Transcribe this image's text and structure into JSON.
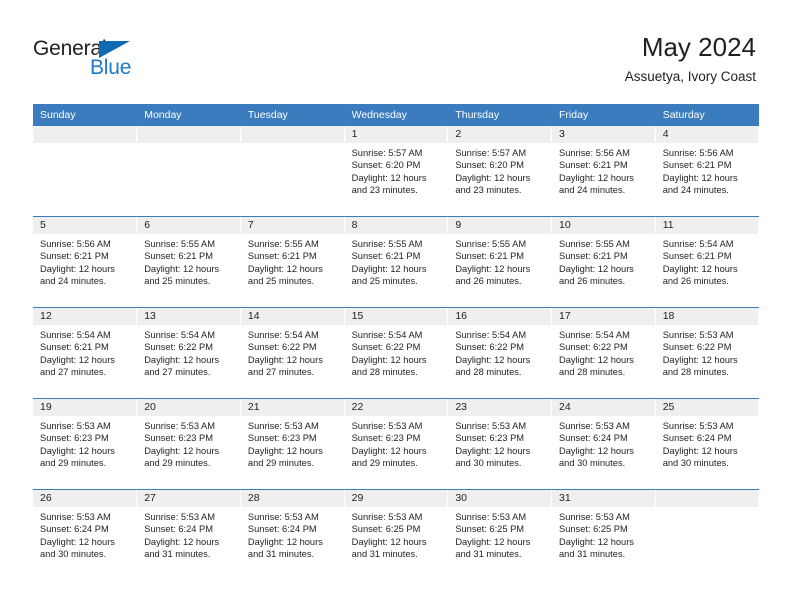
{
  "brand": {
    "name_part1": "General",
    "name_part2": "Blue",
    "triangle_icon": "triangle-icon",
    "primary_color": "#1c7ac9",
    "dark_color": "#231f20"
  },
  "header": {
    "title": "May 2024",
    "subtitle": "Assuetya, Ivory Coast"
  },
  "calendar": {
    "header_bg": "#3a7cbe",
    "daynum_bg": "#efefef",
    "weekday_headers": [
      "Sunday",
      "Monday",
      "Tuesday",
      "Wednesday",
      "Thursday",
      "Friday",
      "Saturday"
    ],
    "weeks": [
      [
        {
          "day": "",
          "lines": []
        },
        {
          "day": "",
          "lines": []
        },
        {
          "day": "",
          "lines": []
        },
        {
          "day": "1",
          "lines": [
            "Sunrise: 5:57 AM",
            "Sunset: 6:20 PM",
            "Daylight: 12 hours",
            "and 23 minutes."
          ]
        },
        {
          "day": "2",
          "lines": [
            "Sunrise: 5:57 AM",
            "Sunset: 6:20 PM",
            "Daylight: 12 hours",
            "and 23 minutes."
          ]
        },
        {
          "day": "3",
          "lines": [
            "Sunrise: 5:56 AM",
            "Sunset: 6:21 PM",
            "Daylight: 12 hours",
            "and 24 minutes."
          ]
        },
        {
          "day": "4",
          "lines": [
            "Sunrise: 5:56 AM",
            "Sunset: 6:21 PM",
            "Daylight: 12 hours",
            "and 24 minutes."
          ]
        }
      ],
      [
        {
          "day": "5",
          "lines": [
            "Sunrise: 5:56 AM",
            "Sunset: 6:21 PM",
            "Daylight: 12 hours",
            "and 24 minutes."
          ]
        },
        {
          "day": "6",
          "lines": [
            "Sunrise: 5:55 AM",
            "Sunset: 6:21 PM",
            "Daylight: 12 hours",
            "and 25 minutes."
          ]
        },
        {
          "day": "7",
          "lines": [
            "Sunrise: 5:55 AM",
            "Sunset: 6:21 PM",
            "Daylight: 12 hours",
            "and 25 minutes."
          ]
        },
        {
          "day": "8",
          "lines": [
            "Sunrise: 5:55 AM",
            "Sunset: 6:21 PM",
            "Daylight: 12 hours",
            "and 25 minutes."
          ]
        },
        {
          "day": "9",
          "lines": [
            "Sunrise: 5:55 AM",
            "Sunset: 6:21 PM",
            "Daylight: 12 hours",
            "and 26 minutes."
          ]
        },
        {
          "day": "10",
          "lines": [
            "Sunrise: 5:55 AM",
            "Sunset: 6:21 PM",
            "Daylight: 12 hours",
            "and 26 minutes."
          ]
        },
        {
          "day": "11",
          "lines": [
            "Sunrise: 5:54 AM",
            "Sunset: 6:21 PM",
            "Daylight: 12 hours",
            "and 26 minutes."
          ]
        }
      ],
      [
        {
          "day": "12",
          "lines": [
            "Sunrise: 5:54 AM",
            "Sunset: 6:21 PM",
            "Daylight: 12 hours",
            "and 27 minutes."
          ]
        },
        {
          "day": "13",
          "lines": [
            "Sunrise: 5:54 AM",
            "Sunset: 6:22 PM",
            "Daylight: 12 hours",
            "and 27 minutes."
          ]
        },
        {
          "day": "14",
          "lines": [
            "Sunrise: 5:54 AM",
            "Sunset: 6:22 PM",
            "Daylight: 12 hours",
            "and 27 minutes."
          ]
        },
        {
          "day": "15",
          "lines": [
            "Sunrise: 5:54 AM",
            "Sunset: 6:22 PM",
            "Daylight: 12 hours",
            "and 28 minutes."
          ]
        },
        {
          "day": "16",
          "lines": [
            "Sunrise: 5:54 AM",
            "Sunset: 6:22 PM",
            "Daylight: 12 hours",
            "and 28 minutes."
          ]
        },
        {
          "day": "17",
          "lines": [
            "Sunrise: 5:54 AM",
            "Sunset: 6:22 PM",
            "Daylight: 12 hours",
            "and 28 minutes."
          ]
        },
        {
          "day": "18",
          "lines": [
            "Sunrise: 5:53 AM",
            "Sunset: 6:22 PM",
            "Daylight: 12 hours",
            "and 28 minutes."
          ]
        }
      ],
      [
        {
          "day": "19",
          "lines": [
            "Sunrise: 5:53 AM",
            "Sunset: 6:23 PM",
            "Daylight: 12 hours",
            "and 29 minutes."
          ]
        },
        {
          "day": "20",
          "lines": [
            "Sunrise: 5:53 AM",
            "Sunset: 6:23 PM",
            "Daylight: 12 hours",
            "and 29 minutes."
          ]
        },
        {
          "day": "21",
          "lines": [
            "Sunrise: 5:53 AM",
            "Sunset: 6:23 PM",
            "Daylight: 12 hours",
            "and 29 minutes."
          ]
        },
        {
          "day": "22",
          "lines": [
            "Sunrise: 5:53 AM",
            "Sunset: 6:23 PM",
            "Daylight: 12 hours",
            "and 29 minutes."
          ]
        },
        {
          "day": "23",
          "lines": [
            "Sunrise: 5:53 AM",
            "Sunset: 6:23 PM",
            "Daylight: 12 hours",
            "and 30 minutes."
          ]
        },
        {
          "day": "24",
          "lines": [
            "Sunrise: 5:53 AM",
            "Sunset: 6:24 PM",
            "Daylight: 12 hours",
            "and 30 minutes."
          ]
        },
        {
          "day": "25",
          "lines": [
            "Sunrise: 5:53 AM",
            "Sunset: 6:24 PM",
            "Daylight: 12 hours",
            "and 30 minutes."
          ]
        }
      ],
      [
        {
          "day": "26",
          "lines": [
            "Sunrise: 5:53 AM",
            "Sunset: 6:24 PM",
            "Daylight: 12 hours",
            "and 30 minutes."
          ]
        },
        {
          "day": "27",
          "lines": [
            "Sunrise: 5:53 AM",
            "Sunset: 6:24 PM",
            "Daylight: 12 hours",
            "and 31 minutes."
          ]
        },
        {
          "day": "28",
          "lines": [
            "Sunrise: 5:53 AM",
            "Sunset: 6:24 PM",
            "Daylight: 12 hours",
            "and 31 minutes."
          ]
        },
        {
          "day": "29",
          "lines": [
            "Sunrise: 5:53 AM",
            "Sunset: 6:25 PM",
            "Daylight: 12 hours",
            "and 31 minutes."
          ]
        },
        {
          "day": "30",
          "lines": [
            "Sunrise: 5:53 AM",
            "Sunset: 6:25 PM",
            "Daylight: 12 hours",
            "and 31 minutes."
          ]
        },
        {
          "day": "31",
          "lines": [
            "Sunrise: 5:53 AM",
            "Sunset: 6:25 PM",
            "Daylight: 12 hours",
            "and 31 minutes."
          ]
        },
        {
          "day": "",
          "lines": []
        }
      ]
    ]
  }
}
